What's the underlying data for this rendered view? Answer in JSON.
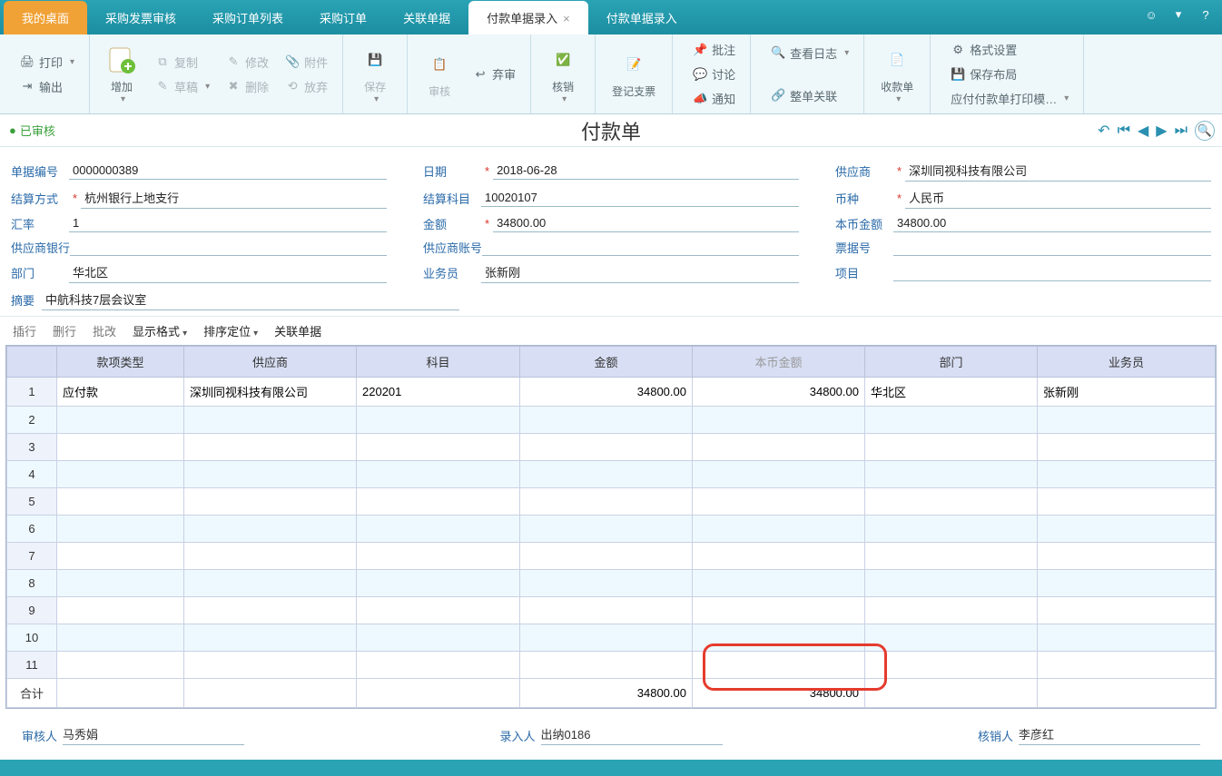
{
  "tabs": {
    "mydesk": "我的桌面",
    "items": [
      "采购发票审核",
      "采购订单列表",
      "采购订单",
      "关联单据"
    ],
    "active": "付款单据录入",
    "after": [
      "付款单据录入"
    ]
  },
  "ribbon": {
    "print": "打印",
    "output": "输出",
    "add": "增加",
    "copy": "复制",
    "draft": "草稿",
    "modify": "修改",
    "delete": "删除",
    "attach": "附件",
    "abandon": "放弃",
    "save": "保存",
    "audit": "审核",
    "discard": "弃审",
    "writeoff": "核销",
    "reg_cheque": "登记支票",
    "remark": "批注",
    "discuss": "讨论",
    "notify": "通知",
    "viewlog": "查看日志",
    "whole_rel": "整单关联",
    "receipt": "收款单",
    "format": "格式设置",
    "savelay": "保存布局",
    "printtpl": "应付付款单打印模…"
  },
  "title": {
    "audited": "已审核",
    "doc": "付款单"
  },
  "form": {
    "doc_no_label": "单据编号",
    "doc_no": "0000000389",
    "date_label": "日期",
    "date": "2018-06-28",
    "supplier_label": "供应商",
    "supplier": "深圳同视科技有限公司",
    "settle_label": "结算方式",
    "settle": "杭州银行上地支行",
    "account_subj_label": "结算科目",
    "account_subj": "10020107",
    "currency_label": "币种",
    "currency": "人民币",
    "rate_label": "汇率",
    "rate": "1",
    "amount_label": "金额",
    "amount": "34800.00",
    "local_amount_label": "本币金额",
    "local_amount": "34800.00",
    "supplier_bank_label": "供应商银行",
    "supplier_bank": "",
    "supplier_acct_label": "供应商账号",
    "supplier_acct": "",
    "bill_no_label": "票据号",
    "bill_no": "",
    "dept_label": "部门",
    "dept": "华北区",
    "salesman_label": "业务员",
    "salesman": "张新刚",
    "project_label": "项目",
    "project": "",
    "summary_label": "摘要",
    "summary": "中航科技7层会议室"
  },
  "gridbar": {
    "insert": "插行",
    "delete": "删行",
    "batch": "批改",
    "display": "显示格式",
    "sort": "排序定位",
    "assoc": "关联单据"
  },
  "grid": {
    "headers": {
      "type": "款项类型",
      "supplier": "供应商",
      "account": "科目",
      "amount": "金额",
      "local": "本币金额",
      "dept": "部门",
      "sales": "业务员"
    },
    "rows": [
      {
        "n": "1",
        "type": "应付款",
        "supplier": "深圳同视科技有限公司",
        "account": "220201",
        "amount": "34800.00",
        "local": "34800.00",
        "dept": "华北区",
        "sales": "张新刚"
      }
    ],
    "empty_count": 10,
    "total_label": "合计",
    "total_amount": "34800.00",
    "total_local": "34800.00"
  },
  "signers": {
    "auditor_label": "审核人",
    "auditor": "马秀娟",
    "entry_label": "录入人",
    "entry": "出纳0186",
    "writeoff_label": "核销人",
    "writeoff": "李彦红"
  }
}
